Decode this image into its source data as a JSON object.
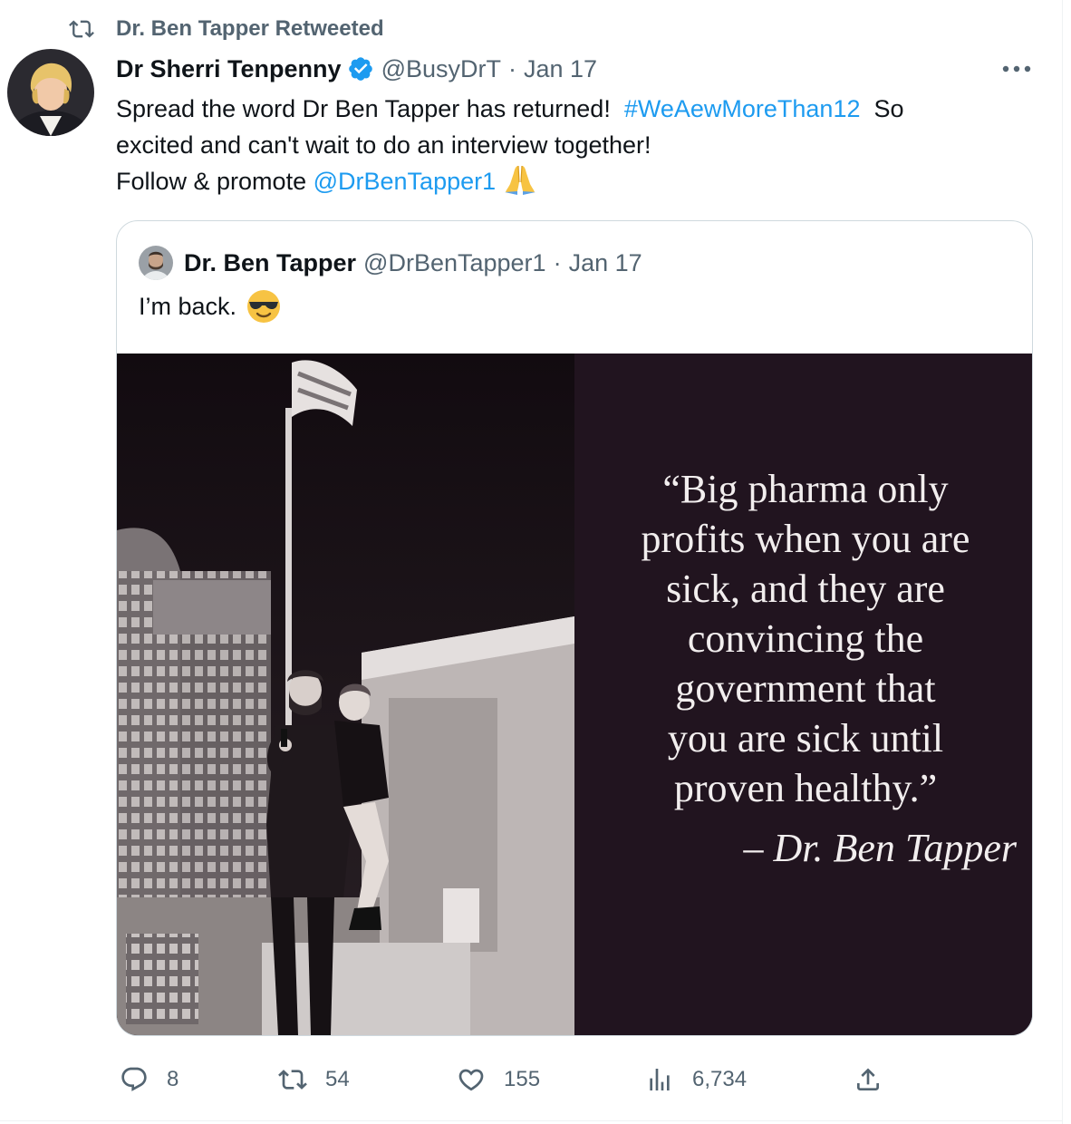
{
  "retweet_banner": {
    "text": "Dr. Ben Tapper Retweeted",
    "icon": "retweet-icon"
  },
  "tweet": {
    "author_name": "Dr Sherri Tenpenny",
    "handle": "@BusyDrT",
    "separator": "·",
    "date": "Jan 17",
    "verified_icon": "verified-badge-icon",
    "more_icon": "more-options-icon",
    "text": {
      "line1_a": "Spread the word Dr Ben Tapper has returned!",
      "hashtag": "#WeAewMoreThan12",
      "line1_b": "So",
      "line2": "excited and can't wait to do an interview together!",
      "line3_a": "Follow  & promote",
      "mention": "@DrBenTapper1",
      "emoji": "folded-hands-emoji"
    }
  },
  "quoted_tweet": {
    "author_name": "Dr. Ben Tapper",
    "handle": "@DrBenTapper1",
    "separator": "·",
    "date": "Jan 17",
    "text": "I’m back.",
    "emoji": "sunglasses-emoji",
    "image": {
      "quote_lines": [
        "“Big pharma only",
        "profits when you are",
        "sick, and they are",
        "convincing the",
        "government that",
        "you are sick until",
        "proven healthy.”"
      ],
      "attribution": "– Dr. Ben Tapper"
    }
  },
  "actions": {
    "reply": {
      "icon": "reply-icon",
      "count": "8"
    },
    "retweet": {
      "icon": "retweet-icon",
      "count": "54"
    },
    "like": {
      "icon": "heart-icon",
      "count": "155"
    },
    "views": {
      "icon": "views-chart-icon",
      "count": "6,734"
    },
    "share": {
      "icon": "share-icon"
    }
  },
  "colors": {
    "link": "#1d9bf0",
    "secondary_text": "#536471",
    "primary_text": "#0f1419",
    "verified": "#1d9bf0",
    "quote_panel_bg": "#21141f"
  }
}
